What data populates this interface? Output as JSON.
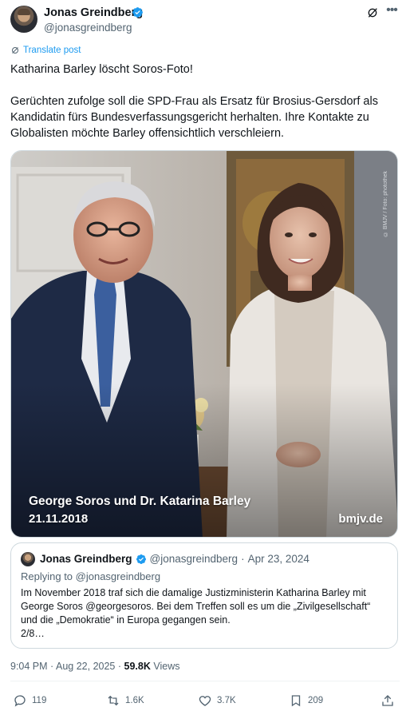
{
  "author": {
    "name": "Jonas Greindberg",
    "handle": "@jonasgreindberg"
  },
  "icons": {
    "verified": "verified-badge-icon",
    "grok": "grok-icon",
    "more": "more-icon",
    "translate": "translate-icon",
    "reply": "reply-icon",
    "repost": "repost-icon",
    "like": "like-icon",
    "bookmark": "bookmark-icon",
    "share": "share-icon"
  },
  "colors": {
    "accent": "#1d9bf0",
    "text": "#0f1419",
    "muted": "#536471"
  },
  "translate_label": "Translate post",
  "tweet": {
    "paragraph1": "Katharina Barley löscht Soros-Foto!",
    "paragraph2": "Gerüchten zufolge soll die SPD-Frau als Ersatz für Brosius-Gersdorf als\nKandidatin fürs Bundesverfassungsgericht herhalten. Ihre Kontakte zu\nGlobalisten möchte Barley offensichtlich verschleiern."
  },
  "media": {
    "caption_main": "George Soros und Dr. Katarina Barley",
    "caption_date": "21.11.2018",
    "caption_site": "bmjv.de",
    "credit": "© BMJV / Foto: photothek"
  },
  "quote": {
    "name": "Jonas Greindberg",
    "handle": "@jonasgreindberg",
    "separator": "·",
    "date": "Apr 23, 2024",
    "replying": "Replying to @jonasgreindberg",
    "text": "Im November 2018 traf sich die damalige Justizministerin Katharina Barley mit\nGeorge Soros @georgesoros. Bei dem Treffen soll es um die „Zivilgesellschaft“\nund die „Demokratie“ in Europa gegangen sein.\n2/8…"
  },
  "meta": {
    "time": "9:04 PM",
    "separator": "·",
    "date": "Aug 22, 2025",
    "views_count": "59.8K",
    "views_label": "Views"
  },
  "actions": {
    "replies": "119",
    "reposts": "1.6K",
    "likes": "3.7K",
    "bookmarks": "209"
  }
}
